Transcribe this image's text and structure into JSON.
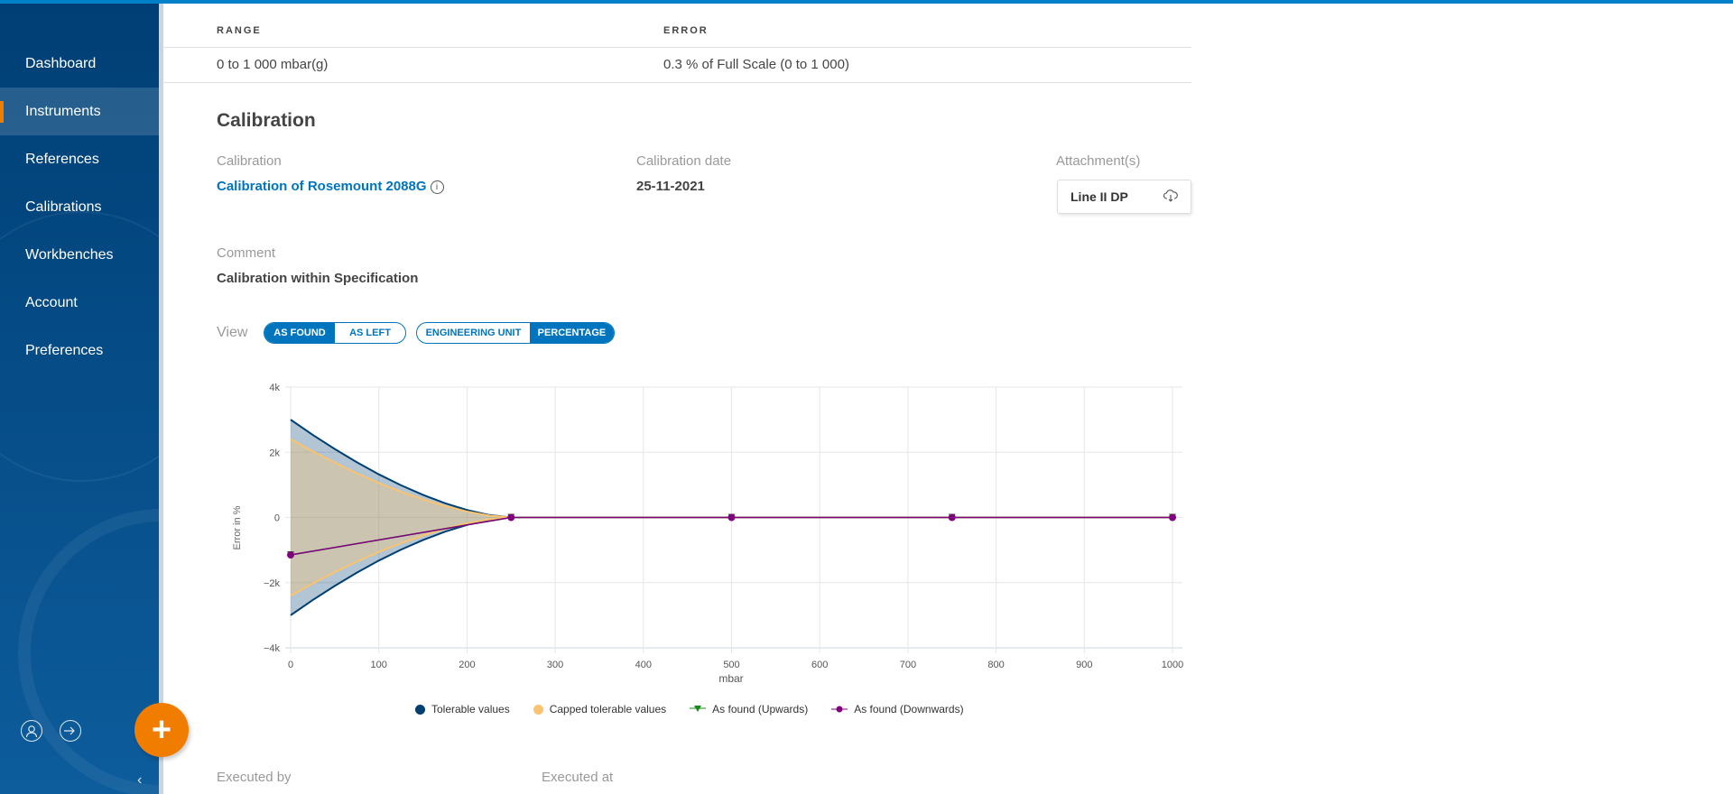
{
  "sidebar": {
    "items": [
      {
        "label": "Dashboard"
      },
      {
        "label": "Instruments",
        "active": true
      },
      {
        "label": "References"
      },
      {
        "label": "Calibrations"
      },
      {
        "label": "Workbenches"
      },
      {
        "label": "Account"
      },
      {
        "label": "Preferences"
      }
    ],
    "add_label": "+",
    "collapse_label": "‹"
  },
  "spec_table": {
    "headers": [
      "RANGE",
      "ERROR"
    ],
    "row": [
      "0 to 1 000 mbar(g)",
      "0.3 % of Full Scale (0 to 1 000)"
    ]
  },
  "calibration": {
    "title": "Calibration",
    "calibration_label": "Calibration",
    "calibration_value": "Calibration of Rosemount 2088G",
    "info_glyph": "i",
    "date_label": "Calibration date",
    "date_value": "25-11-2021",
    "attachments_label": "Attachment(s)",
    "attachment_name": "Line II DP",
    "comment_label": "Comment",
    "comment_value": "Calibration within Specification",
    "view_label": "View",
    "view_toggle": [
      "AS FOUND",
      "AS LEFT"
    ],
    "unit_toggle": [
      "ENGINEERING UNIT",
      "PERCENTAGE"
    ],
    "executed_by_label": "Executed by",
    "executed_at_label": "Executed at"
  },
  "colors": {
    "accent": "#0075be",
    "orange": "#f07c00",
    "tolerable": "#003f72",
    "capped": "#f9c36f",
    "up": "#1a8a1a",
    "down": "#800080"
  },
  "chart_data": {
    "type": "line",
    "xlabel": "mbar",
    "ylabel": "Error in %",
    "xlim": [
      0,
      1000
    ],
    "ylim": [
      -4000,
      4000
    ],
    "xticks": [
      0,
      100,
      200,
      300,
      400,
      500,
      600,
      700,
      800,
      900,
      1000
    ],
    "yticks": [
      {
        "v": 4000,
        "label": "4k"
      },
      {
        "v": 2000,
        "label": "2k"
      },
      {
        "v": 0,
        "label": "0"
      },
      {
        "v": -2000,
        "label": "−2k"
      },
      {
        "v": -4000,
        "label": "−4k"
      }
    ],
    "grid": true,
    "legend_placement": "bottom",
    "series": [
      {
        "name": "Tolerable values",
        "x": [
          0,
          25,
          50,
          75,
          100,
          125,
          150,
          175,
          200,
          225,
          250,
          1000
        ],
        "upper": [
          3000,
          2535,
          2100,
          1695,
          1323,
          990,
          693,
          438,
          228,
          75,
          0,
          0
        ]
      },
      {
        "name": "Capped tolerable values",
        "x": [
          0,
          25,
          50,
          75,
          100,
          125,
          150,
          175,
          200,
          225,
          250,
          1000
        ],
        "upper": [
          2400,
          2028,
          1680,
          1356,
          1058,
          792,
          554,
          350,
          182,
          60,
          0,
          0
        ]
      },
      {
        "name": "As found (Upwards)",
        "x": [
          0,
          250,
          500,
          750,
          1000
        ],
        "y": [
          -1150,
          0,
          0,
          0,
          0
        ]
      },
      {
        "name": "As found (Downwards)",
        "x": [
          0,
          250,
          500,
          750,
          1000
        ],
        "y": [
          -1150,
          0,
          0,
          0,
          0
        ]
      }
    ]
  }
}
